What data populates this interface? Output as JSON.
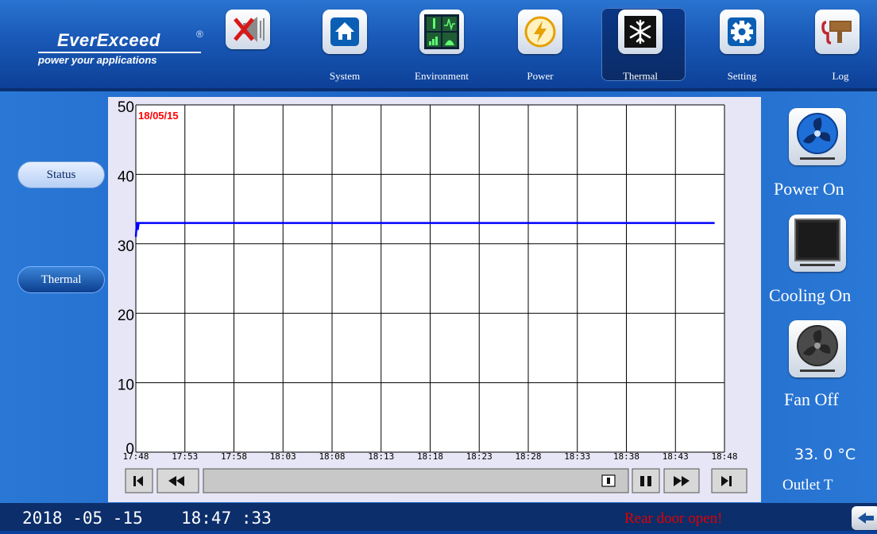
{
  "brand": {
    "name": "EverExceed",
    "reg_mark": "®",
    "tagline": "power your applications"
  },
  "nav": [
    {
      "id": "mute",
      "label": "",
      "icon": "speaker-muted-icon"
    },
    {
      "id": "system",
      "label": "System",
      "icon": "home-icon"
    },
    {
      "id": "environment",
      "label": "Environment",
      "icon": "environment-monitor-icon"
    },
    {
      "id": "power",
      "label": "Power",
      "icon": "lightning-bolt-icon"
    },
    {
      "id": "thermal",
      "label": "Thermal",
      "icon": "snowflake-icon",
      "selected": true
    },
    {
      "id": "setting",
      "label": "Setting",
      "icon": "gear-icon"
    },
    {
      "id": "log",
      "label": "Log",
      "icon": "log-icon"
    }
  ],
  "side_tabs": {
    "status": "Status",
    "thermal": "Thermal"
  },
  "chart_data": {
    "type": "line",
    "date_label": "18/05/15",
    "yticks": [
      "0",
      "10",
      "20",
      "30",
      "40",
      "50"
    ],
    "ylim": [
      0,
      50
    ],
    "xticks": [
      "17:48",
      "17:53",
      "17:58",
      "18:03",
      "18:08",
      "18:13",
      "18:18",
      "18:23",
      "18:28",
      "18:33",
      "18:38",
      "18:43",
      "18:48"
    ],
    "series": [
      {
        "color": "#0000ff",
        "x": [
          "17:48",
          "17:48",
          "17:48",
          "17:48",
          "17:48",
          "18:47"
        ],
        "y": [
          31,
          33,
          32,
          33,
          33,
          33
        ]
      }
    ],
    "grid": true
  },
  "playback": {
    "first": "first-icon",
    "rewind": "rewind-icon",
    "window": "window-icon",
    "pause": "pause-icon",
    "forward": "fast-forward-icon",
    "last": "last-icon"
  },
  "status": {
    "power": "Power On",
    "cooling": "Cooling On",
    "fan": "Fan Off",
    "outlet_value": "33. 0 °C",
    "outlet_label": "Outlet T"
  },
  "footer": {
    "date": "2018 -05 -15",
    "time": "18:47 :33",
    "alarm": "Rear door open!"
  },
  "colors": {
    "accent": "#1b61c3",
    "line": "#0000ff",
    "alarm": "#e00000",
    "date": "#ff0000"
  }
}
